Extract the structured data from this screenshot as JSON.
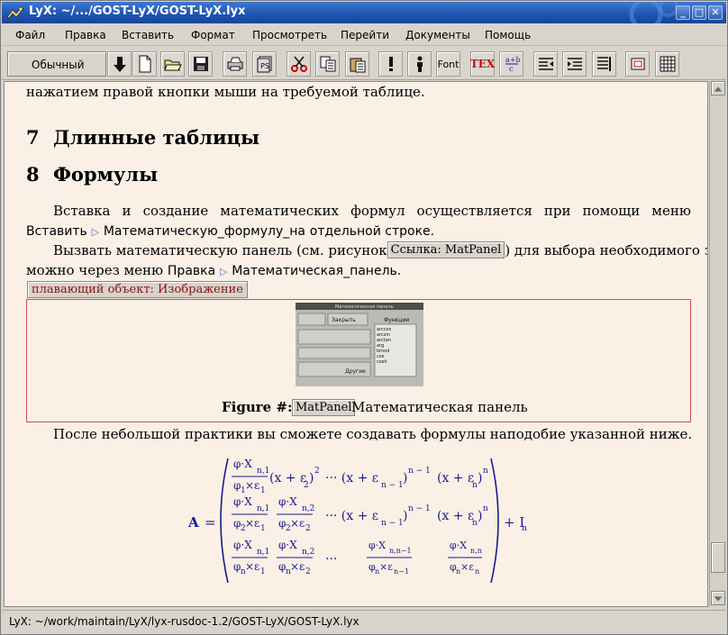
{
  "window": {
    "title": "LyX: ~/.../GOST-LyX/GOST-LyX.lyx"
  },
  "titlebar_buttons": {
    "minimize": "_",
    "maximize": "□",
    "close": "✕"
  },
  "menu": {
    "items": [
      {
        "label": "Файл"
      },
      {
        "label": "Правка"
      },
      {
        "label": "Вставить"
      },
      {
        "label": "Формат"
      },
      {
        "label": "Просмотреть"
      },
      {
        "label": "Перейти"
      },
      {
        "label": "Документы"
      },
      {
        "label": "Помощь"
      }
    ]
  },
  "toolbar": {
    "layout_value": "Обычный",
    "font_label": "Font",
    "tex_label": "TEX"
  },
  "document": {
    "line1": "нажатием правой кнопки мыши на требуемой таблице.",
    "section7": {
      "number": "7",
      "title": "Длинные таблицы"
    },
    "section8": {
      "number": "8",
      "title": "Формулы"
    },
    "para1_line1": [
      "Вставка",
      "и",
      "создание",
      "математических",
      "формул",
      "осуществляется",
      "при",
      "помощи",
      "меню"
    ],
    "para1_line2_menu1": "Вставить",
    "para1_line2_menu2": "Математическую_формулу_на",
    "para1_line2_rest": "отдельной строке.",
    "para2_line1_start": "Вызвать математическую панель (см. рисунок",
    "para2_ref": "Ссылка: MatPanel",
    "para2_line1_end": ") для выбора необходимого знака",
    "para2_line2_start": "можно через меню",
    "para2_menu1": "Правка",
    "para2_menu2": "Математическая_панель.",
    "float_label": "плавающий объект: Изображение",
    "figure_caption_prefix": "Figure #:",
    "figure_label": "MatPanel",
    "figure_caption_text": "Математическая панель",
    "panel_window_title": "Математическая панель",
    "panel_close": "Закрыть",
    "panel_functions_title": "Функции",
    "panel_functions": [
      "arccos",
      "arcsin",
      "arctan",
      "arg",
      "bmod",
      "cos",
      "cosh"
    ],
    "panel_other": "Другие",
    "para3": "После небольшой практики вы сможете создавать формулы наподобие указанной ниже."
  },
  "status": {
    "text": "LyX: ~/work/maintain/LyX/lyx-rusdoc-1.2/GOST-LyX/GOST-LyX.lyx"
  },
  "colors": {
    "titlebar": "#1e56b4",
    "document_bg": "#faf0e6",
    "math": "#1a1a8c",
    "float_border": "#d05050",
    "float_label": "#8b1010"
  }
}
